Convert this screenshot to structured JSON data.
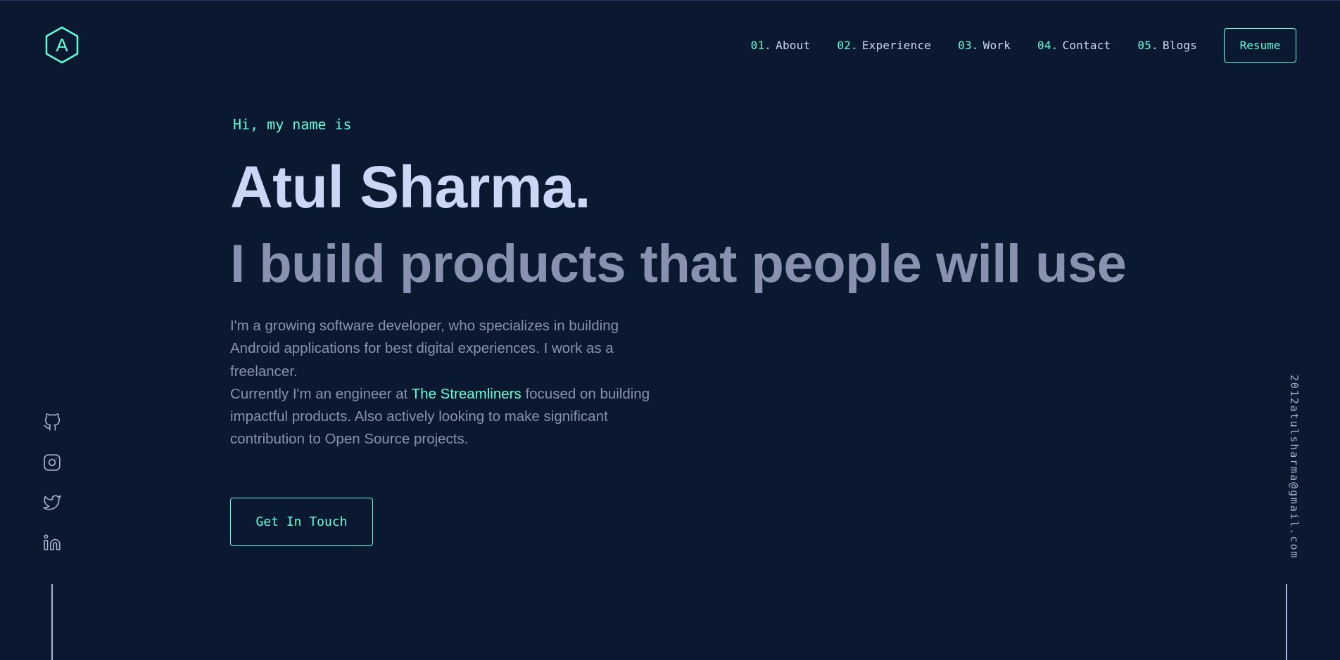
{
  "logo": {
    "letter": "A",
    "color": "#64ffda"
  },
  "nav": {
    "items": [
      {
        "num": "01.",
        "label": "About"
      },
      {
        "num": "02.",
        "label": "Experience"
      },
      {
        "num": "03.",
        "label": "Work"
      },
      {
        "num": "04.",
        "label": "Contact"
      },
      {
        "num": "05.",
        "label": "Blogs"
      }
    ],
    "resume_label": "Resume"
  },
  "hero": {
    "greeting": "Hi, my name is",
    "name": "Atul Sharma.",
    "tagline": "I build products that people will use",
    "bio_line1": "I'm a growing software developer, who specializes in building Android applications for best digital experiences. I work as a freelancer.",
    "bio_line2_prefix": "Currently I'm an engineer at ",
    "company": "The Streamliners",
    "bio_line2_suffix": " focused on building impactful products. Also actively looking to make significant contribution to Open Source projects.",
    "cta_label": "Get In Touch"
  },
  "socials": [
    {
      "icon": "github-icon"
    },
    {
      "icon": "instagram-icon"
    },
    {
      "icon": "twitter-icon"
    },
    {
      "icon": "linkedin-icon"
    }
  ],
  "email": "2012atulsharma@gmail.com",
  "colors": {
    "background": "#0a192f",
    "accent": "#64ffda",
    "heading": "#ccd6f6",
    "body": "#8892b0"
  }
}
